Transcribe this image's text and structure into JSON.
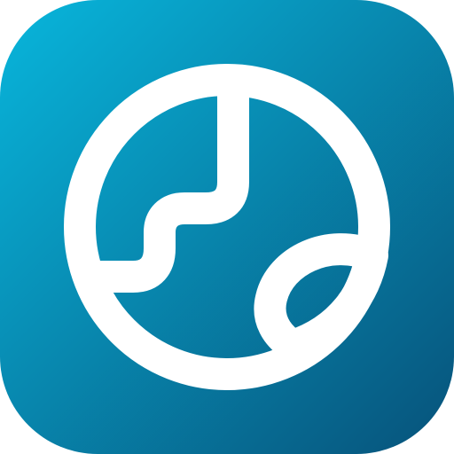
{
  "icon": {
    "name": "globe-icon",
    "tile_gradient": [
      "#08b6dc",
      "#07527a"
    ],
    "glyph_color": "#ffffff"
  }
}
